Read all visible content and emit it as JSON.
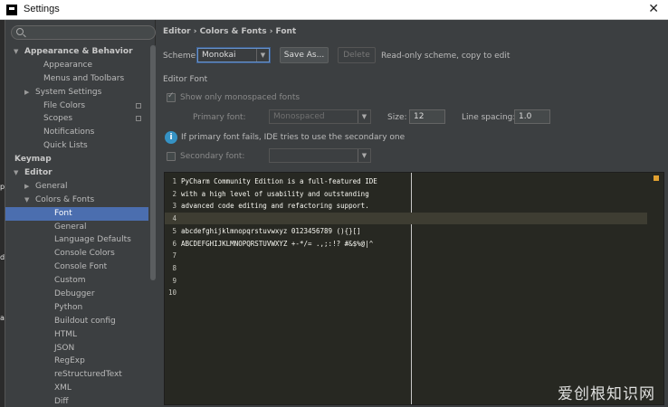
{
  "window": {
    "title": "Settings",
    "close_glyph": "✕"
  },
  "left_edge_chars": [
    "p",
    "d",
    "a"
  ],
  "sidebar": {
    "items": [
      {
        "label": "Appearance & Behavior",
        "level": 0,
        "bold": true,
        "arrow": "▼"
      },
      {
        "label": "Appearance",
        "level": 2
      },
      {
        "label": "Menus and Toolbars",
        "level": 2
      },
      {
        "label": "System Settings",
        "level": 1,
        "arrow": "▶"
      },
      {
        "label": "File Colors",
        "level": 2,
        "copy": true
      },
      {
        "label": "Scopes",
        "level": 2,
        "copy": true
      },
      {
        "label": "Notifications",
        "level": 2
      },
      {
        "label": "Quick Lists",
        "level": 2
      },
      {
        "label": "Keymap",
        "level": 0,
        "bold": true
      },
      {
        "label": "Editor",
        "level": 0,
        "bold": true,
        "arrow": "▼"
      },
      {
        "label": "General",
        "level": 1,
        "arrow": "▶"
      },
      {
        "label": "Colors & Fonts",
        "level": 1,
        "arrow": "▼"
      },
      {
        "label": "Font",
        "level": 3,
        "selected": true
      },
      {
        "label": "General",
        "level": 3
      },
      {
        "label": "Language Defaults",
        "level": 3
      },
      {
        "label": "Console Colors",
        "level": 3
      },
      {
        "label": "Console Font",
        "level": 3
      },
      {
        "label": "Custom",
        "level": 3
      },
      {
        "label": "Debugger",
        "level": 3
      },
      {
        "label": "Python",
        "level": 3
      },
      {
        "label": "Buildout config",
        "level": 3
      },
      {
        "label": "HTML",
        "level": 3
      },
      {
        "label": "JSON",
        "level": 3
      },
      {
        "label": "RegExp",
        "level": 3
      },
      {
        "label": "reStructuredText",
        "level": 3
      },
      {
        "label": "XML",
        "level": 3
      },
      {
        "label": "Diff",
        "level": 3
      }
    ]
  },
  "main": {
    "breadcrumb": "Editor › Colors & Fonts › Font",
    "scheme_label": "Scheme:",
    "scheme_value": "Monokai",
    "save_as_label": "Save As...",
    "delete_label": "Delete",
    "readonly_note": "Read-only scheme, copy to edit",
    "editor_font_section": "Editor Font",
    "monospaced_label": "Show only monospaced fonts",
    "primary_font_label": "Primary font:",
    "primary_font_value": "Monospaced",
    "size_label": "Size:",
    "size_value": "12",
    "line_spacing_label": "Line spacing:",
    "line_spacing_value": "1.0",
    "info_text": "If primary font fails, IDE tries to use the secondary one",
    "secondary_font_label": "Secondary font:"
  },
  "preview": {
    "lines": [
      "PyCharm Community Edition is a full-featured IDE",
      "with a high level of usability and outstanding",
      "advanced code editing and refactoring support.",
      "",
      "abcdefghijklmnopqrstuvwxyz 0123456789 (){}[]",
      "ABCDEFGHIJKLMNOPQRSTUVWXYZ +-*/= .,;:!? #&$%@|^",
      "",
      "",
      "",
      ""
    ],
    "current_line": 4
  },
  "watermark": "爱创根知识网",
  "colors": {
    "selection": "#4b6eaf",
    "editor_bg": "#272822",
    "panel_bg": "#3c3f41",
    "info_blue": "#3592c4",
    "marker_orange": "#e0a030"
  }
}
